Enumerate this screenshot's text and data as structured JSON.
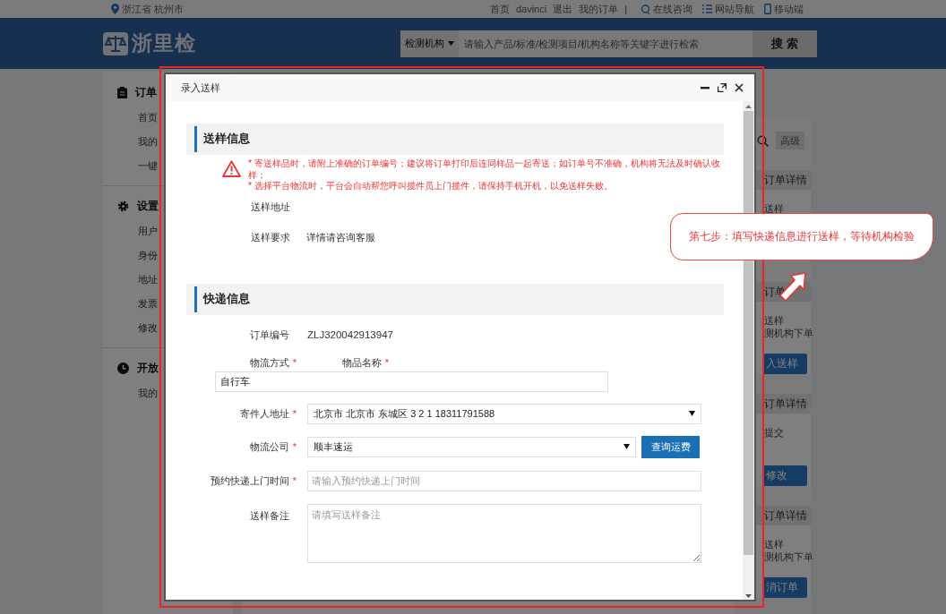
{
  "topbar": {
    "location": "浙江省 杭州市",
    "links": [
      "首页",
      "davinci",
      "退出",
      "我的订单"
    ],
    "separator": "|",
    "tools": [
      {
        "kind": "chat",
        "label": "在线咨询"
      },
      {
        "kind": "list",
        "label": "网站导航"
      },
      {
        "kind": "phone",
        "label": "移动端"
      }
    ]
  },
  "header": {
    "logo": "浙里检",
    "search": {
      "category": "检测机构",
      "placeholder": "请输入产品/标准/检测项目/机构名称等关键字进行检索",
      "button": "搜 索"
    }
  },
  "sidebar": [
    {
      "kind": "clipboard",
      "title": "订单",
      "items": [
        "首页",
        "我的",
        "一键"
      ]
    },
    {
      "kind": "gear",
      "title": "设置",
      "items": [
        "用户",
        "身份",
        "地址",
        "发票",
        "修改"
      ]
    },
    {
      "kind": "clock",
      "title": "开放",
      "items": [
        "我的"
      ]
    }
  ],
  "right_panel": {
    "advanced": "高级",
    "cards": [
      {
        "header": "订单详情",
        "lines": [
          "送样"
        ]
      },
      {
        "header": "订单",
        "lines": [
          "送样",
          "测机构下单"
        ],
        "button": "入送样"
      },
      {
        "header": "订单详情",
        "lines": [
          "提交"
        ],
        "button": "修改"
      },
      {
        "header": "订单详情",
        "lines": [
          "送样",
          "测机构下单"
        ],
        "button": "消订单"
      }
    ]
  },
  "modal": {
    "title": "录入送样",
    "sample_section": {
      "title": "送样信息",
      "warnings": [
        "* 寄送样品时，请附上准确的订单编号；建议将订单打印后连同样品一起寄送；如订单号不准确，机构将无法及时确认收样；",
        "* 选择平台物流时，平台会自动帮您呼叫揽件员上门揽件，请保持手机开机，以免送样失败。"
      ],
      "rows": [
        {
          "label": "送样地址"
        },
        {
          "label": "送样要求",
          "value": "详情请咨询客服"
        }
      ]
    },
    "delivery_section": {
      "title": "快递信息",
      "fields": [
        {
          "kind": "static",
          "label": "订单编号",
          "value": "ZLJ320042913947"
        },
        {
          "kind": "stacked",
          "label": "物流方式",
          "mark": "*",
          "label2": "物品名称",
          "mark2": "*",
          "value": "自行车"
        },
        {
          "kind": "select",
          "label": "寄件人地址",
          "mark": "*",
          "value": "北京市 北京市 东城区 3 2 1 18311791588"
        },
        {
          "kind": "select",
          "label": "物流公司",
          "mark": "*",
          "value": "顺丰速运",
          "button": "查询运费"
        },
        {
          "kind": "input",
          "label": "预约快递上门时间",
          "mark": "*",
          "placeholder": "请输入预约快递上门时间"
        },
        {
          "kind": "textarea",
          "label": "送样备注",
          "placeholder": "请填写送样备注"
        }
      ]
    }
  },
  "callout": {
    "text": "第七步：填写快递信息进行送样，等待机构检验"
  }
}
